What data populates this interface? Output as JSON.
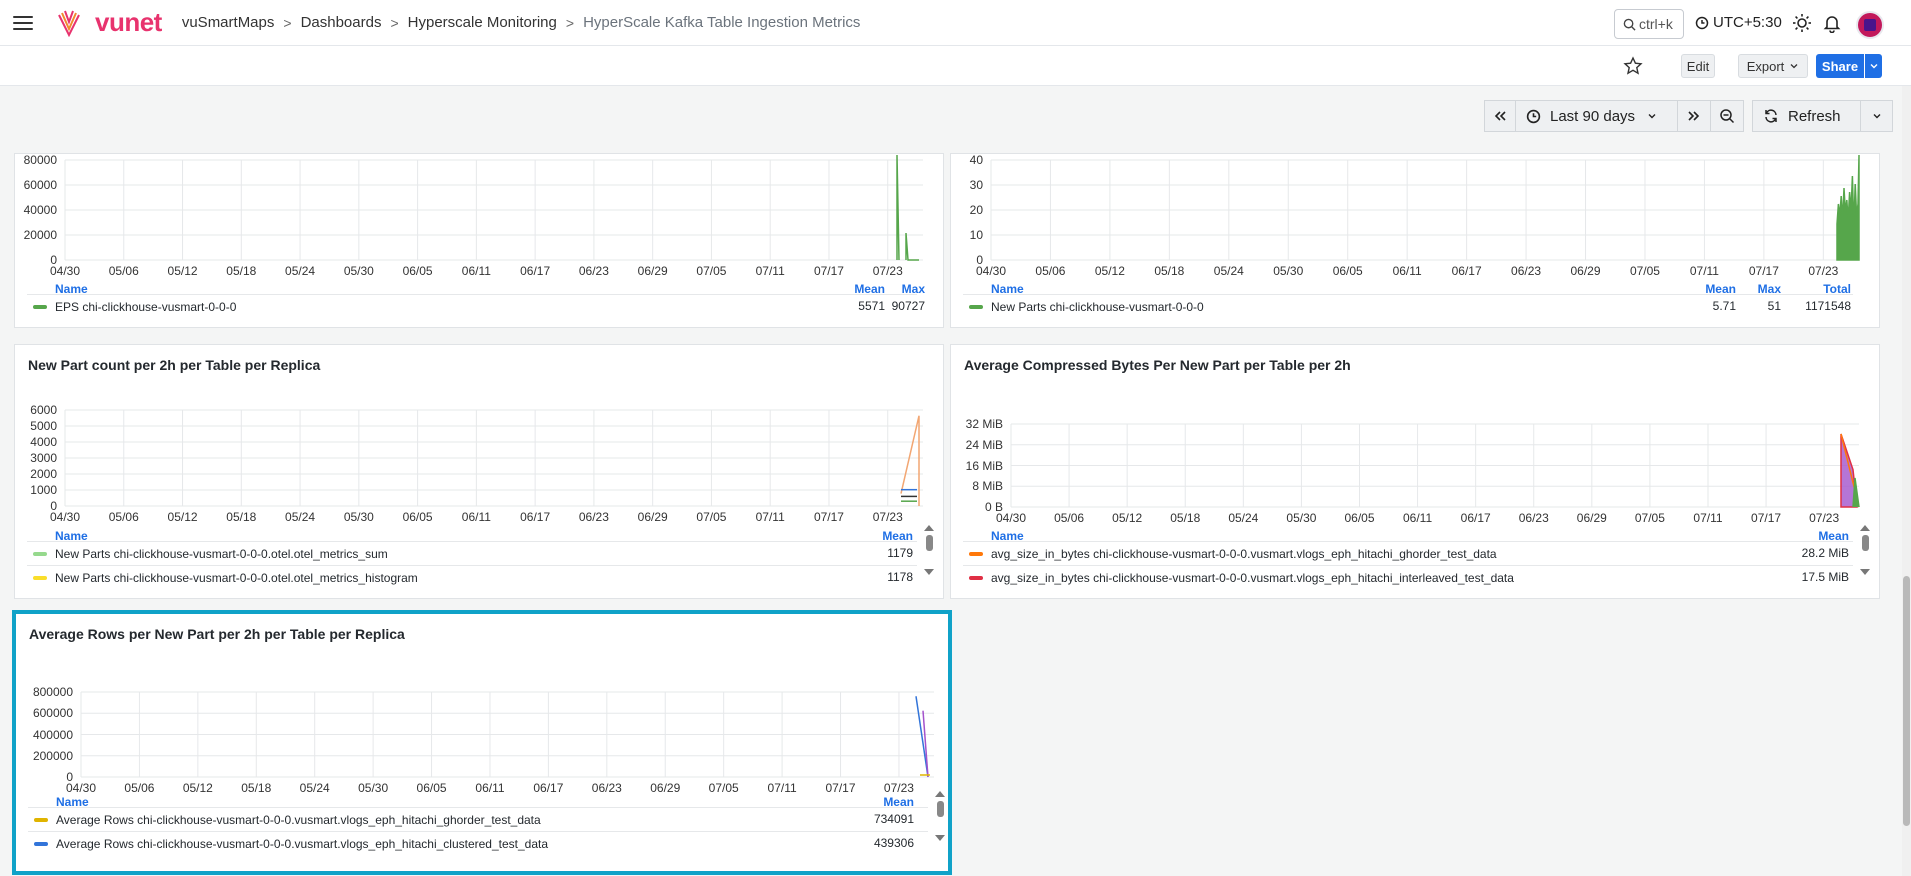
{
  "header": {
    "logo_text": "vunet",
    "breadcrumbs": [
      "vuSmartMaps",
      "Dashboards",
      "Hyperscale Monitoring",
      "HyperScale Kafka Table Ingestion Metrics"
    ],
    "search_placeholder": "ctrl+k",
    "timezone": "UTC+5:30"
  },
  "toolbar": {
    "edit_label": "Edit",
    "export_label": "Export",
    "share_label": "Share"
  },
  "timepicker": {
    "range_label": "Last 90 days",
    "refresh_label": "Refresh"
  },
  "colors": {
    "accent": "#1f6fe5",
    "selected_border": "#10a2c8",
    "green": "#56a64b",
    "orange": "#ff780a",
    "red": "#e02f44",
    "purple": "#a352cc",
    "yellow": "#e0b400",
    "lightgreen": "#96d98d",
    "blue": "#3274d9"
  },
  "x_ticks": [
    "04/30",
    "05/06",
    "05/12",
    "05/18",
    "05/24",
    "05/30",
    "06/05",
    "06/11",
    "06/17",
    "06/23",
    "06/29",
    "07/05",
    "07/11",
    "07/17",
    "07/23"
  ],
  "panels": [
    {
      "id": "eps",
      "title": "",
      "y_ticks": [
        "80000",
        "60000",
        "40000",
        "20000",
        "0"
      ],
      "legend_headers": [
        "Name",
        "Mean",
        "Max"
      ],
      "legend": [
        {
          "name": "EPS chi-clickhouse-vusmart-0-0-0",
          "values": [
            "5571",
            "90727"
          ],
          "color": "#56a64b"
        }
      ]
    },
    {
      "id": "newparts",
      "title": "",
      "y_ticks": [
        "40",
        "30",
        "20",
        "10",
        "0"
      ],
      "legend_headers": [
        "Name",
        "Mean",
        "Max",
        "Total"
      ],
      "legend": [
        {
          "name": "New Parts chi-clickhouse-vusmart-0-0-0",
          "values": [
            "5.71",
            "51",
            "1171548"
          ],
          "color": "#56a64b"
        }
      ]
    },
    {
      "id": "partcount",
      "title": "New Part count per 2h per Table per Replica",
      "y_ticks": [
        "6000",
        "5000",
        "4000",
        "3000",
        "2000",
        "1000",
        "0"
      ],
      "legend_headers": [
        "Name",
        "Mean"
      ],
      "legend": [
        {
          "name": "New Parts chi-clickhouse-vusmart-0-0-0.otel.otel_metrics_sum",
          "values": [
            "1179"
          ],
          "color": "#96d98d"
        },
        {
          "name": "New Parts chi-clickhouse-vusmart-0-0-0.otel.otel_metrics_histogram",
          "values": [
            "1178"
          ],
          "color": "#fade2a"
        }
      ]
    },
    {
      "id": "compressed",
      "title": "Average Compressed Bytes Per New Part per Table per 2h",
      "y_ticks": [
        "32 MiB",
        "24 MiB",
        "16 MiB",
        "8 MiB",
        "0 B"
      ],
      "legend_headers": [
        "Name",
        "Mean"
      ],
      "legend": [
        {
          "name": "avg_size_in_bytes chi-clickhouse-vusmart-0-0-0.vusmart.vlogs_eph_hitachi_ghorder_test_data",
          "values": [
            "28.2 MiB"
          ],
          "color": "#ff780a"
        },
        {
          "name": "avg_size_in_bytes chi-clickhouse-vusmart-0-0-0.vusmart.vlogs_eph_hitachi_interleaved_test_data",
          "values": [
            "17.5 MiB"
          ],
          "color": "#e02f44"
        }
      ]
    },
    {
      "id": "avgrows",
      "title": "Average Rows per New Part per 2h per Table per Replica",
      "y_ticks": [
        "800000",
        "600000",
        "400000",
        "200000",
        "0"
      ],
      "legend_headers": [
        "Name",
        "Mean"
      ],
      "legend": [
        {
          "name": "Average Rows chi-clickhouse-vusmart-0-0-0.vusmart.vlogs_eph_hitachi_ghorder_test_data",
          "values": [
            "734091"
          ],
          "color": "#e0b400"
        },
        {
          "name": "Average Rows chi-clickhouse-vusmart-0-0-0.vusmart.vlogs_eph_hitachi_clustered_test_data",
          "values": [
            "439306"
          ],
          "color": "#3274d9"
        }
      ]
    }
  ]
}
